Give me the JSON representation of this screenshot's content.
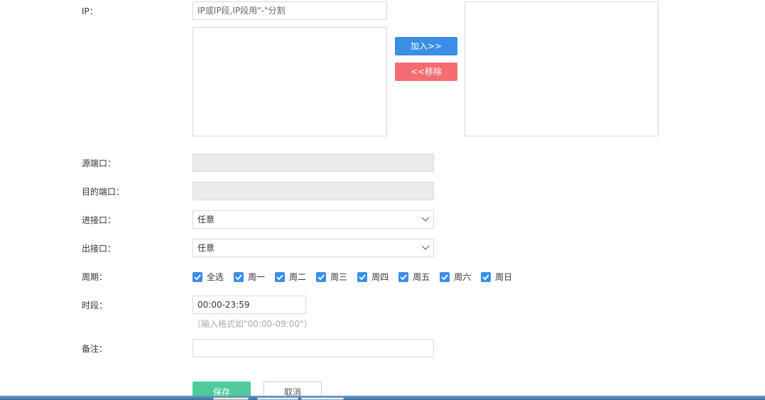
{
  "ip": {
    "label": "IP：",
    "placeholder": "IP或IP段,IP段用\"-\"分割",
    "add_button": "加入>>",
    "remove_button": "<<移除"
  },
  "src_port": {
    "label": "源端口：",
    "value": ""
  },
  "dst_port": {
    "label": "目的端口：",
    "value": ""
  },
  "in_interface": {
    "label": "进接口：",
    "value": "任意"
  },
  "out_interface": {
    "label": "出接口：",
    "value": "任意"
  },
  "period": {
    "label": "周期：",
    "days": [
      "全选",
      "周一",
      "周二",
      "周三",
      "周四",
      "周五",
      "周六",
      "周日"
    ],
    "checked": [
      true,
      true,
      true,
      true,
      true,
      true,
      true,
      true
    ],
    "accent": "#3a8ee6"
  },
  "time": {
    "label": "时段：",
    "value": "00:00-23:59",
    "hint": "（输入格式如\"00:00-09:00\"）"
  },
  "remark": {
    "label": "备注：",
    "value": ""
  },
  "actions": {
    "save": "保存",
    "cancel": "取消"
  },
  "colors": {
    "primary": "#3a8ee6",
    "danger": "#f56d72",
    "success": "#4dcb9b"
  }
}
